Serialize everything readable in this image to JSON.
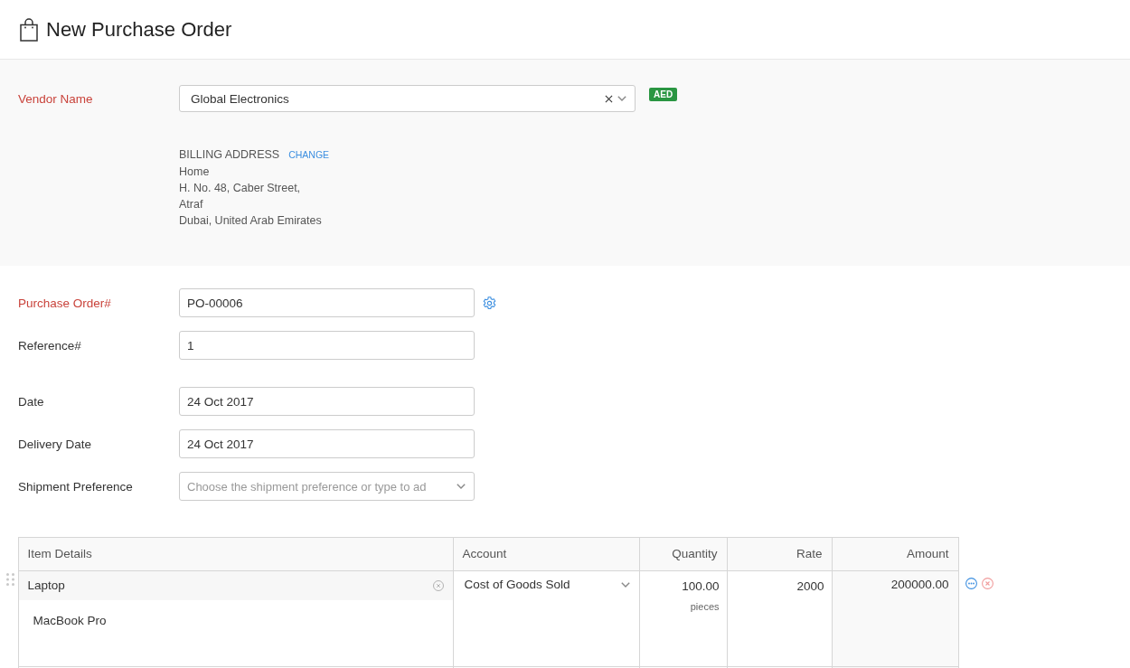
{
  "header": {
    "title": "New Purchase Order"
  },
  "vendor": {
    "label": "Vendor Name",
    "required": true,
    "value": "Global Electronics",
    "currency": "AED",
    "billing_address": {
      "heading": "BILLING ADDRESS",
      "action": "CHANGE",
      "lines": [
        "Home",
        "H. No. 48, Caber Street,",
        "Atraf",
        "Dubai, United Arab Emirates"
      ]
    }
  },
  "field_groups": [
    {
      "fields": [
        {
          "kind": "text",
          "label": "Purchase Order#",
          "required": true,
          "value": "PO-00006",
          "settings": true
        },
        {
          "kind": "text",
          "label": "Reference#",
          "required": false,
          "value": "1",
          "settings": false
        }
      ]
    },
    {
      "fields": [
        {
          "kind": "text",
          "label": "Date",
          "required": false,
          "value": "24 Oct 2017",
          "settings": false
        },
        {
          "kind": "text",
          "label": "Delivery Date",
          "required": false,
          "value": "24 Oct 2017",
          "settings": false
        },
        {
          "kind": "select",
          "label": "Shipment Preference",
          "required": false,
          "placeholder": "Choose the shipment preference or type to ad",
          "settings": false
        }
      ]
    }
  ],
  "items_table": {
    "columns": [
      "Item Details",
      "Account",
      "Quantity",
      "Rate",
      "Amount"
    ],
    "rows": [
      {
        "item": "Laptop",
        "description": "MacBook Pro",
        "account": "Cost of Goods Sold",
        "quantity": "100.00",
        "unit": "pieces",
        "rate": "2000",
        "amount": "200000.00"
      }
    ]
  }
}
